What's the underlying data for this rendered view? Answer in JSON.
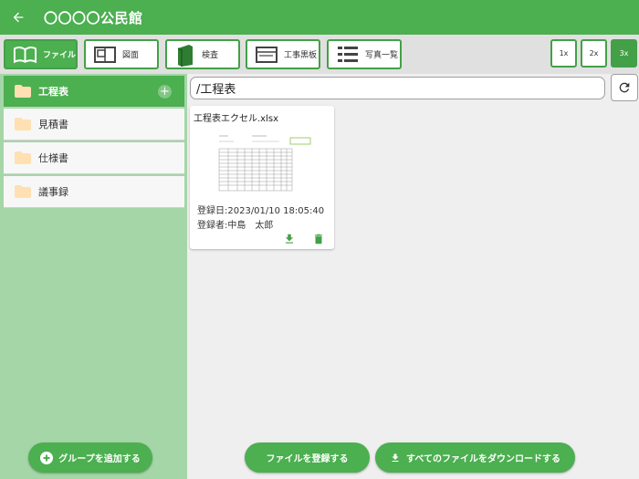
{
  "header": {
    "title": "〇〇〇〇公民館"
  },
  "toolbar": {
    "buttons": [
      {
        "label": "ファイル",
        "icon": "book-icon",
        "active": true
      },
      {
        "label": "図面",
        "icon": "floorplan-icon",
        "active": false
      },
      {
        "label": "検査",
        "icon": "binder-icon",
        "active": false
      },
      {
        "label": "工事黒板",
        "icon": "blackboard-icon",
        "active": false
      },
      {
        "label": "写真一覧",
        "icon": "list-icon",
        "active": false
      }
    ],
    "zoom": [
      "1x",
      "2x",
      "3x"
    ],
    "zoom_selected": "3x"
  },
  "sidebar": {
    "items": [
      {
        "label": "工程表",
        "icon": "folder-icon",
        "active": true
      },
      {
        "label": "見積書",
        "icon": "folder-icon",
        "active": false
      },
      {
        "label": "仕様書",
        "icon": "folder-icon",
        "active": false
      },
      {
        "label": "議事録",
        "icon": "folder-icon",
        "active": false
      }
    ],
    "add_group_label": "グループを追加する"
  },
  "main": {
    "path": "/工程表",
    "files": [
      {
        "name": "工程表エクセル.xlsx",
        "registered_date": "登録日:2023/01/10 18:05:40",
        "registered_by": "登録者:中島　太郎"
      }
    ]
  },
  "footer": {
    "register_label": "ファイルを登録する",
    "download_all_label": "すべてのファイルをダウンロードする"
  },
  "colors": {
    "primary": "#4caf50",
    "primary_dark": "#43a047",
    "sidebar_bg": "#a5d6a7",
    "folder": "#ffe0b2"
  }
}
